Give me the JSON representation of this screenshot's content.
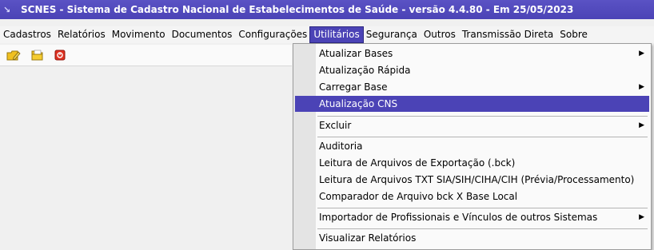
{
  "window": {
    "title": "SCNES - Sistema de Cadastro Nacional de Estabelecimentos de Saúde - versão 4.4.80   -  Em 25/05/2023",
    "icon": "down-arrow-icon"
  },
  "menubar": {
    "items": [
      {
        "label": "Cadastros",
        "mnemonic": "C"
      },
      {
        "label": "Relatórios",
        "mnemonic": "R"
      },
      {
        "label": "Movimento",
        "mnemonic": "M"
      },
      {
        "label": "Documentos",
        "mnemonic": "D"
      },
      {
        "label": "Configurações",
        "mnemonic": "f"
      },
      {
        "label": "Utilitários",
        "mnemonic": "U",
        "active": true
      },
      {
        "label": "Segurança",
        "mnemonic": "S"
      },
      {
        "label": "Outros",
        "mnemonic": "O"
      },
      {
        "label": "Transmissão Direta",
        "mnemonic": "T"
      },
      {
        "label": "Sobre",
        "mnemonic": "b"
      }
    ]
  },
  "toolbar": {
    "buttons": [
      {
        "icon": "pencil-folder-icon",
        "color": "#f0c020"
      },
      {
        "icon": "open-folder-icon",
        "color": "#f0c020"
      },
      {
        "icon": "stop-icon",
        "color": "#e03020"
      }
    ]
  },
  "dropdown": {
    "items": [
      {
        "label": "Atualizar Bases",
        "submenu": true
      },
      {
        "label": "Atualização Rápida",
        "submenu": false
      },
      {
        "label": "Carregar Base",
        "submenu": true
      },
      {
        "label": "Atualização CNS",
        "submenu": false,
        "highlighted": true
      },
      {
        "label": "Excluir",
        "submenu": true
      },
      {
        "label": "Auditoria",
        "submenu": false
      },
      {
        "label": "Leitura de Arquivos de Exportação (.bck)",
        "submenu": false
      },
      {
        "label": "Leitura de Arquivos TXT SIA/SIH/CIHA/CIH (Prévia/Processamento)",
        "submenu": false
      },
      {
        "label": "Comparador de Arquivo bck X  Base Local",
        "submenu": false
      },
      {
        "label": "Importador de Profissionais e Vínculos de outros Sistemas",
        "submenu": true
      },
      {
        "label": "Visualizar Relatórios",
        "submenu": false
      }
    ]
  },
  "colors": {
    "accent": "#4b43b6",
    "menu_bg": "#fafafa",
    "gutter": "#e4e4e4"
  }
}
